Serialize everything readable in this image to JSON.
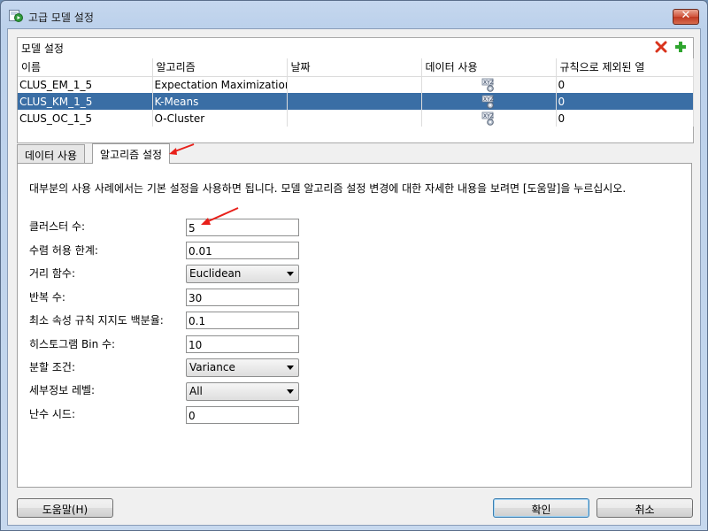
{
  "window": {
    "title": "고급 모델 설정",
    "close_label": "✕"
  },
  "model_panel": {
    "title": "모델 설정",
    "columns": [
      "이름",
      "알고리즘",
      "날짜",
      "데이터 사용",
      "규칙으로 제외된 열"
    ],
    "rows": [
      {
        "name": "CLUS_EM_1_5",
        "algorithm": "Expectation Maximization",
        "date": "",
        "data_usage_icon": "xyz-data-icon",
        "excluded": "0"
      },
      {
        "name": "CLUS_KM_1_5",
        "algorithm": "K-Means",
        "date": "",
        "data_usage_icon": "xyz-data-icon",
        "excluded": "0"
      },
      {
        "name": "CLUS_OC_1_5",
        "algorithm": "O-Cluster",
        "date": "",
        "data_usage_icon": "xyz-data-icon",
        "excluded": "0"
      }
    ],
    "selected_row": 1
  },
  "tabs": [
    {
      "label": "데이터 사용"
    },
    {
      "label": "알고리즘 설정"
    }
  ],
  "active_tab": 1,
  "settings": {
    "info": "대부분의 사용 사례에서는 기본 설정을 사용하면 됩니다. 모델 알고리즘 설정 변경에 대한 자세한 내용을 보려면 [도움말]을 누르십시오.",
    "fields": [
      {
        "label": "클러스터 수:",
        "value": "5"
      },
      {
        "label": "수렴 허용 한계:",
        "value": "0.01"
      },
      {
        "label": "거리 함수:",
        "value": "Euclidean"
      },
      {
        "label": "반복 수:",
        "value": "30"
      },
      {
        "label": "최소 속성 규칙 지지도 백분율:",
        "value": "0.1"
      },
      {
        "label": "히스토그램 Bin 수:",
        "value": "10"
      },
      {
        "label": "분할 조건:",
        "value": "Variance"
      },
      {
        "label": "세부정보 레벨:",
        "value": "All"
      },
      {
        "label": "난수 시드:",
        "value": "0"
      }
    ]
  },
  "buttons": {
    "help": "도움말(H)",
    "ok": "확인",
    "cancel": "취소"
  },
  "colors": {
    "selection": "#3a6ea5",
    "annotation_arrow": "#e8201a",
    "delete": "#d9331c",
    "add": "#2fa52f"
  }
}
